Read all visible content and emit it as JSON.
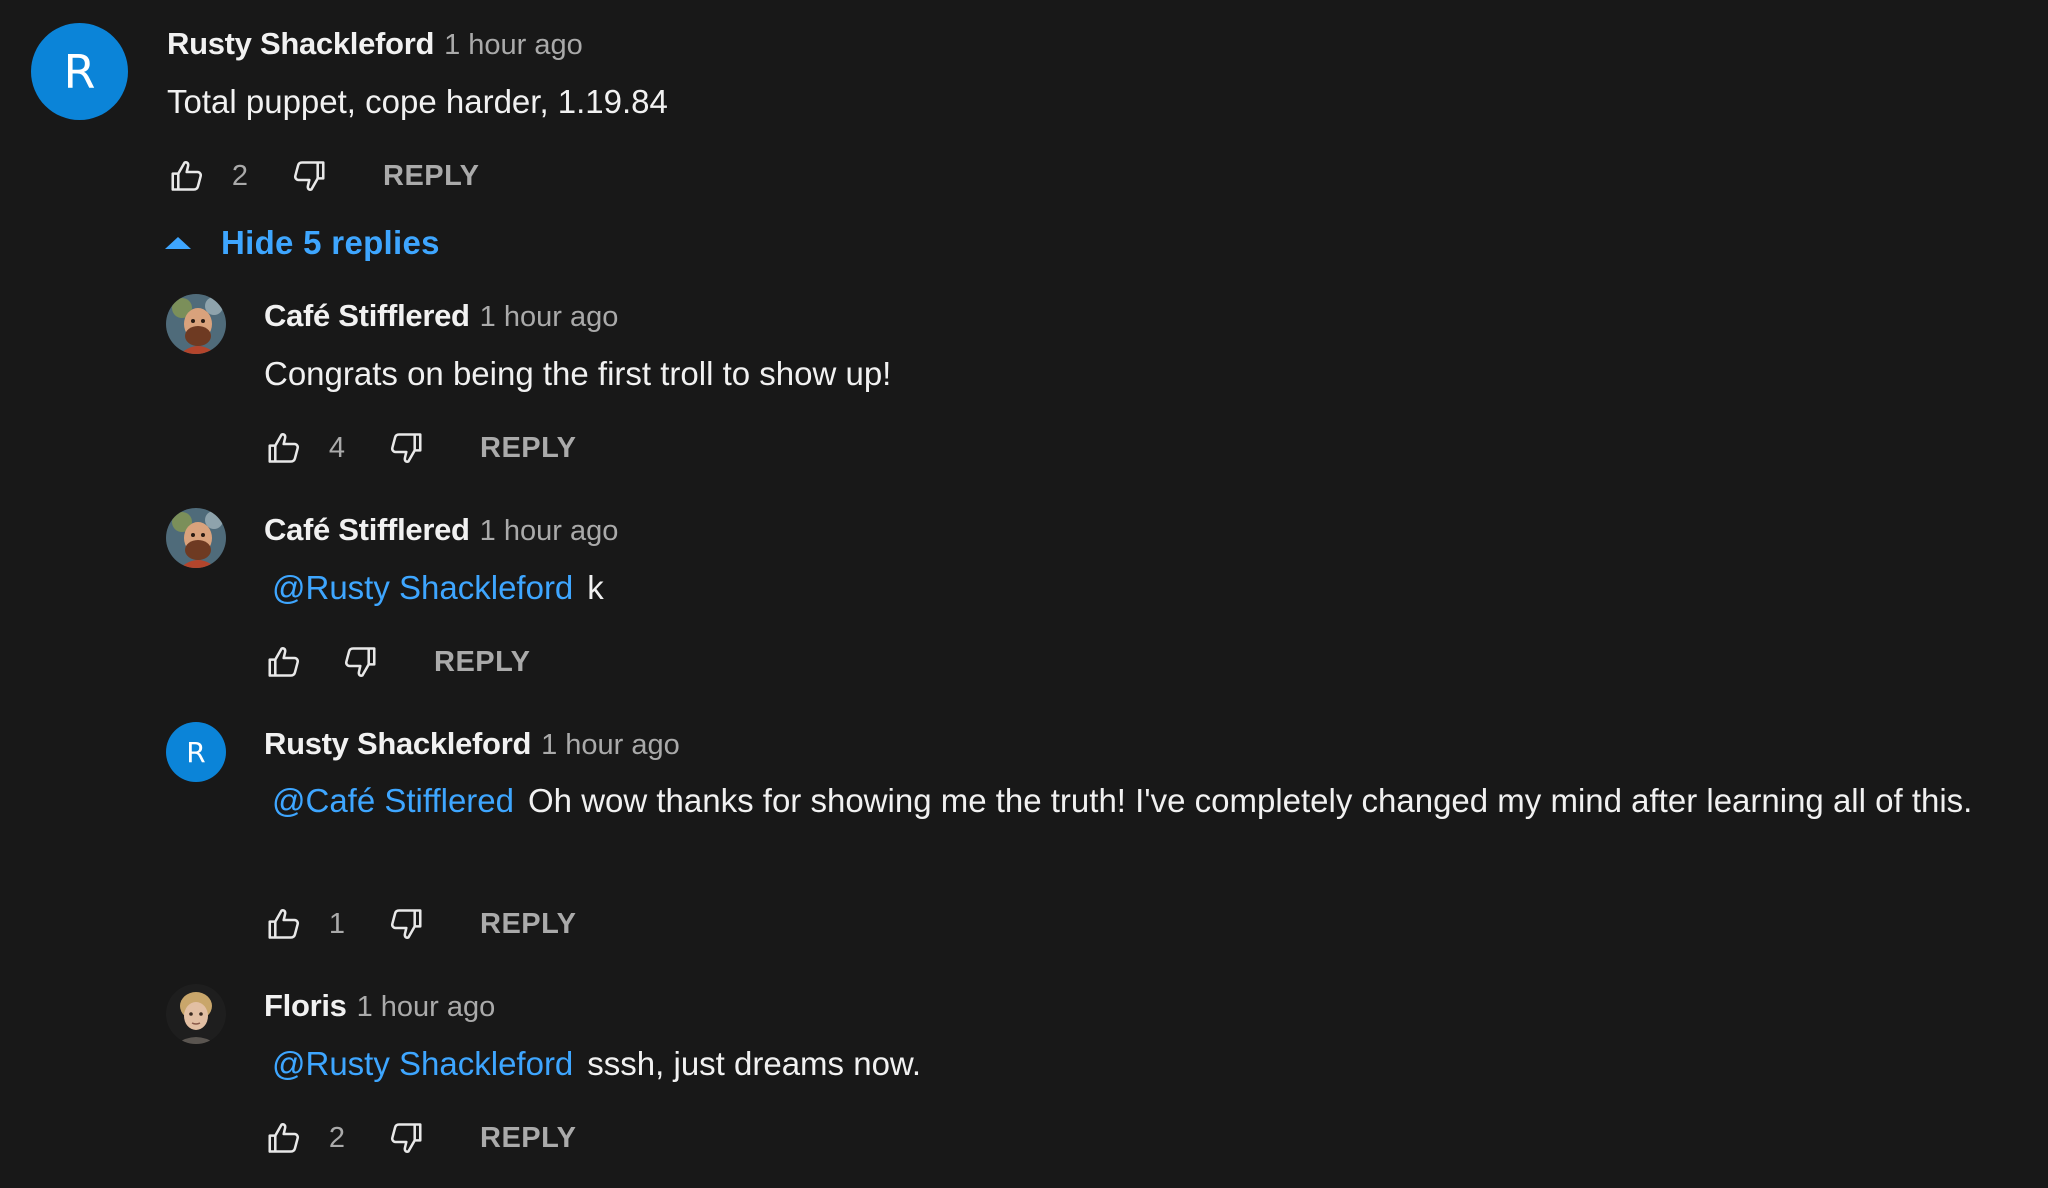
{
  "top_comment": {
    "avatar_letter": "R",
    "author": "Rusty Shackleford",
    "time": "1 hour ago",
    "text": "Total puppet, cope harder, 1.19.84",
    "likes": "2",
    "reply_label": "REPLY"
  },
  "toggle": {
    "label": "Hide 5 replies"
  },
  "replies": [
    {
      "author": "Café Stifflered",
      "time": "1 hour ago",
      "mention": "",
      "text": "Congrats on being the first troll to show up!",
      "likes": "4",
      "reply_label": "REPLY"
    },
    {
      "author": "Café Stifflered",
      "time": "1 hour ago",
      "mention": "@Rusty Shackleford",
      "text": "k",
      "likes": "",
      "reply_label": "REPLY"
    },
    {
      "avatar_letter": "R",
      "author": "Rusty Shackleford",
      "time": "1 hour ago",
      "mention": "@Café Stifflered",
      "text": "Oh wow thanks for showing me the truth! I've completely changed my mind after learning all of this.",
      "likes": "1",
      "reply_label": "REPLY"
    },
    {
      "author": "Floris",
      "time": "1 hour ago",
      "mention": "@Rusty Shackleford",
      "text": "sssh, just dreams now.",
      "likes": "2",
      "reply_label": "REPLY"
    }
  ],
  "colors": {
    "background": "#181818",
    "text": "#f1f1f1",
    "secondary": "#aaaaaa",
    "link": "#3ea6ff",
    "avatar": "#0b84d8"
  },
  "icons": {
    "like": "thumbs-up-icon",
    "dislike": "thumbs-down-icon",
    "toggle": "caret-up-icon"
  }
}
